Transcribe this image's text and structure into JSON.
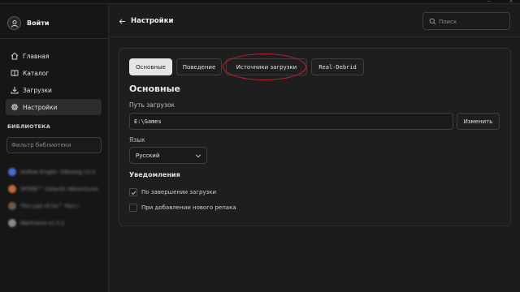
{
  "sidebar": {
    "profile_label": "Войти",
    "nav": [
      {
        "label": "Главная",
        "icon": "home-icon"
      },
      {
        "label": "Каталог",
        "icon": "catalog-icon"
      },
      {
        "label": "Загрузки",
        "icon": "download-icon"
      },
      {
        "label": "Настройки",
        "icon": "gear-icon"
      }
    ],
    "library_heading": "БИБЛИОТЕКА",
    "library_filter_placeholder": "Фильтр библиотеки",
    "library_items": [
      {
        "name": "Hollow Knight: Silksong v1.0",
        "color": "#4a6bd0"
      },
      {
        "name": "SPORE™ Galactic Adventures",
        "color": "#c26b3a"
      },
      {
        "name": "The Last of Us™ Part I",
        "color": "#6e5a4a"
      },
      {
        "name": "Warframe v1.0.2",
        "color": "#8a8a8a"
      }
    ]
  },
  "header": {
    "title": "Настройки",
    "search_placeholder": "Поиск"
  },
  "settings": {
    "tabs": [
      "Основные",
      "Поведение",
      "Источники загрузки",
      "Real-Debrid"
    ],
    "active_tab": 0,
    "section_title": "Основные",
    "download_path_label": "Путь загрузок",
    "download_path_value": "E:\\Games",
    "change_button": "Изменить",
    "language_label": "Язык",
    "language_value": "Русский",
    "notifications_title": "Уведомления",
    "options": [
      {
        "label": "По завершении загрузки",
        "checked": true
      },
      {
        "label": "При добавлении нового репака",
        "checked": false
      }
    ]
  },
  "colors": {
    "background": "#1c1c1c",
    "sidebar": "#161616",
    "active_tab": "#e5e5e5",
    "annotation": "#c8202c"
  }
}
